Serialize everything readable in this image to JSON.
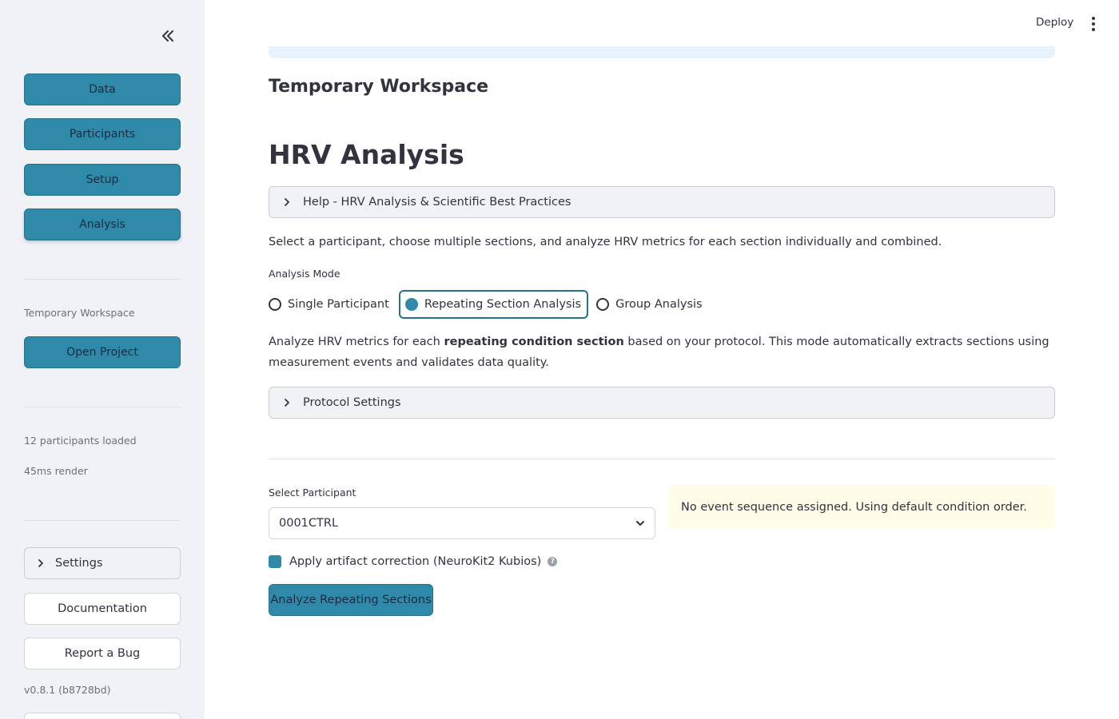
{
  "app": {
    "deploy_label": "Deploy",
    "menu_icon": "kebab-menu-icon"
  },
  "sidebar": {
    "collapse_icon": "chevrons-left-icon",
    "nav": [
      {
        "label": "Data"
      },
      {
        "label": "Participants"
      },
      {
        "label": "Setup"
      },
      {
        "label": "Analysis",
        "active": true
      }
    ],
    "workspace_caption": "Temporary Workspace",
    "open_project_label": "Open Project",
    "participants_loaded": "12 participants loaded",
    "render_time": "45ms render",
    "settings_label": "Settings",
    "documentation_label": "Documentation",
    "report_bug_label": "Report a Bug",
    "version": "v0.8.1 (b8728bd)"
  },
  "main": {
    "workspace_title": "Temporary Workspace",
    "page_title": "HRV Analysis",
    "help_expander": "Help - HRV Analysis & Scientific Best Practices",
    "intro_text": "Select a participant, choose multiple sections, and analyze HRV metrics for each section individually and combined.",
    "analysis_mode": {
      "label": "Analysis Mode",
      "options": [
        "Single Participant",
        "Repeating Section Analysis",
        "Group Analysis"
      ],
      "selected": "Repeating Section Analysis"
    },
    "mode_description": {
      "prefix": "Analyze HRV metrics for each ",
      "bold": "repeating condition section",
      "suffix": " based on your protocol. This mode automatically extracts sections using measurement events and validates data quality."
    },
    "protocol_expander": "Protocol Settings",
    "select_participant": {
      "label": "Select Participant",
      "value": "0001CTRL"
    },
    "warning": "No event sequence assigned. Using default condition order.",
    "artifact_checkbox": {
      "label": "Apply artifact correction (NeuroKit2 Kubios)",
      "checked": true
    },
    "analyze_button": "Analyze Repeating Sections"
  },
  "colors": {
    "primary": "#2e8aa8",
    "sidebar_bg": "#f0f2f6",
    "warning_bg": "#fffce7",
    "info_bg": "#e8f1fc"
  }
}
